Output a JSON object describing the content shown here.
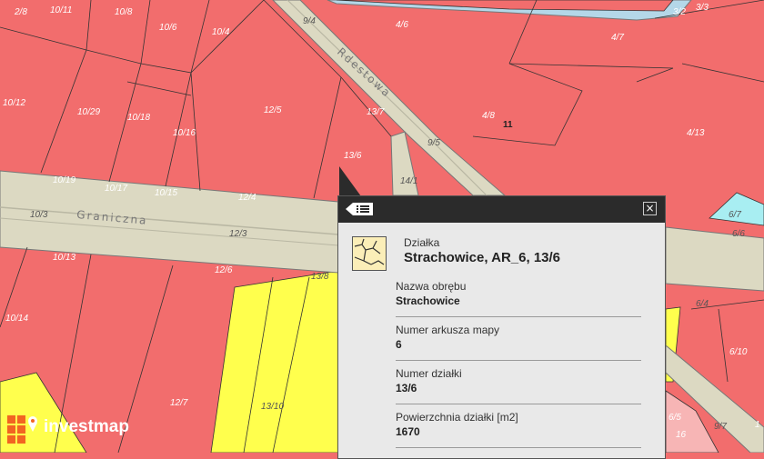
{
  "map": {
    "streets": {
      "graniczna": "Graniczna",
      "rdestowa": "Rdestowa"
    },
    "address_number": "11",
    "parcels": {
      "p_2_8": "2/8",
      "p_10_11": "10/11",
      "p_10_8": "10/8",
      "p_10_6": "10/6",
      "p_10_4": "10/4",
      "p_9_4": "9/4",
      "p_4_6": "4/6",
      "p_3_2": "3/2",
      "p_3_3": "3/3",
      "p_4_7": "4/7",
      "p_10_12": "10/12",
      "p_10_29": "10/29",
      "p_10_18": "10/18",
      "p_10_16": "10/16",
      "p_12_5": "12/5",
      "p_13_7": "13/7",
      "p_4_8": "4/8",
      "p_9_5": "9/5",
      "p_4_13": "4/13",
      "p_13_6": "13/6",
      "p_14_1": "14/1",
      "p_10_19": "10/19",
      "p_10_17": "10/17",
      "p_10_15": "10/15",
      "p_12_4": "12/4",
      "p_10_3": "10/3",
      "p_12_3": "12/3",
      "p_10_13": "10/13",
      "p_12_6": "12/6",
      "p_13_8": "13/8",
      "p_10_14": "10/14",
      "p_12_7": "12/7",
      "p_13_10": "13/10",
      "p_6_7": "6/7",
      "p_6_6": "6/6",
      "p_6_4": "6/4",
      "p_6_10": "6/10",
      "p_6_5": "6/5",
      "p_9_7": "9/7",
      "p_1": "1",
      "p_16": "16"
    }
  },
  "popup": {
    "kicker": "Działka",
    "title": "Strachowice, AR_6, 13/6",
    "fields": [
      {
        "label": "Nazwa obrębu",
        "value": "Strachowice"
      },
      {
        "label": "Numer arkusza mapy",
        "value": "6"
      },
      {
        "label": "Numer działki",
        "value": "13/6"
      },
      {
        "label": "Powierzchnia działki [m2]",
        "value": "1670"
      }
    ],
    "close_icon": "×",
    "menu_icon": "menu-list-icon"
  },
  "logo": {
    "text": "investmap",
    "icon": "investmap-logo-icon"
  },
  "colors": {
    "plot_red": "#f26d6d",
    "plot_yellow": "#ffff4d",
    "road_beige": "#dcd9c2",
    "water_blue": "#b4d7e8",
    "cyan": "#a8eef2",
    "pink": "#f7b5b5",
    "popup_header": "#2b2b2b",
    "popup_body": "#e9e9e9"
  }
}
